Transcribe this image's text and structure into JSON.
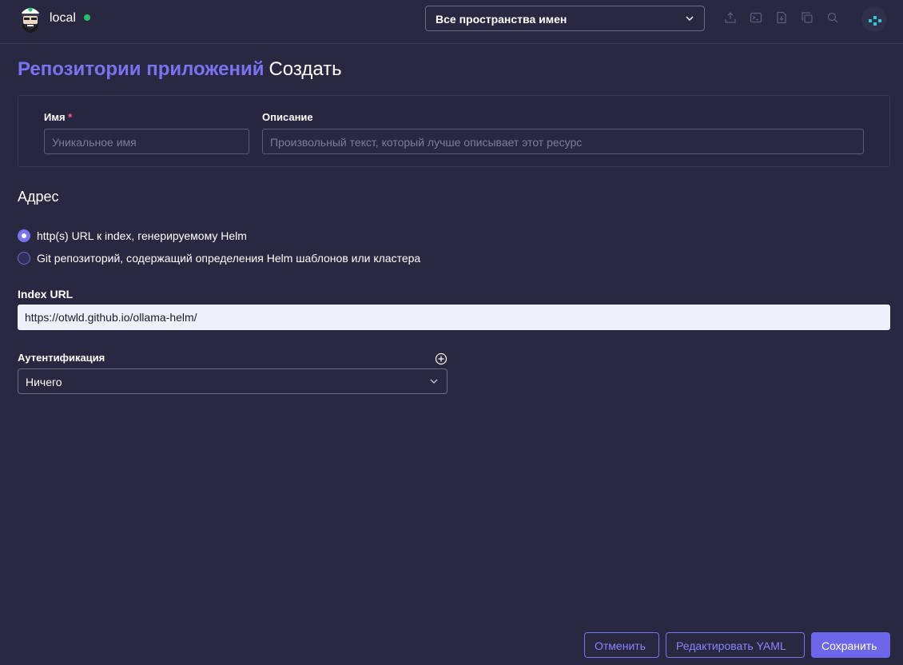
{
  "header": {
    "cluster_name": "local",
    "namespace_select": "Все пространства имен"
  },
  "page": {
    "breadcrumb": "Репозитории приложений",
    "current": "Создать"
  },
  "form": {
    "name_label": "Имя",
    "name_required": "*",
    "name_placeholder": "Уникальное имя",
    "description_label": "Описание",
    "description_placeholder": "Произвольный текст, который лучше описывает этот ресурс",
    "address_title": "Адрес",
    "radio_helm": "http(s) URL к index, генерируемому Helm",
    "radio_git": "Git репозиторий, содержащий определения Helm шаблонов или кластера",
    "index_url_label": "Index URL",
    "index_url_value": "https://otwld.github.io/ollama-helm/",
    "auth_label": "Аутентификация",
    "auth_value": "Ничего"
  },
  "footer": {
    "cancel": "Отменить",
    "edit_yaml": "Редактировать YAML",
    "save": "Сохранить"
  },
  "colors": {
    "background": "#282841",
    "accent": "#7b72f2",
    "status_ok": "#21c46a"
  }
}
